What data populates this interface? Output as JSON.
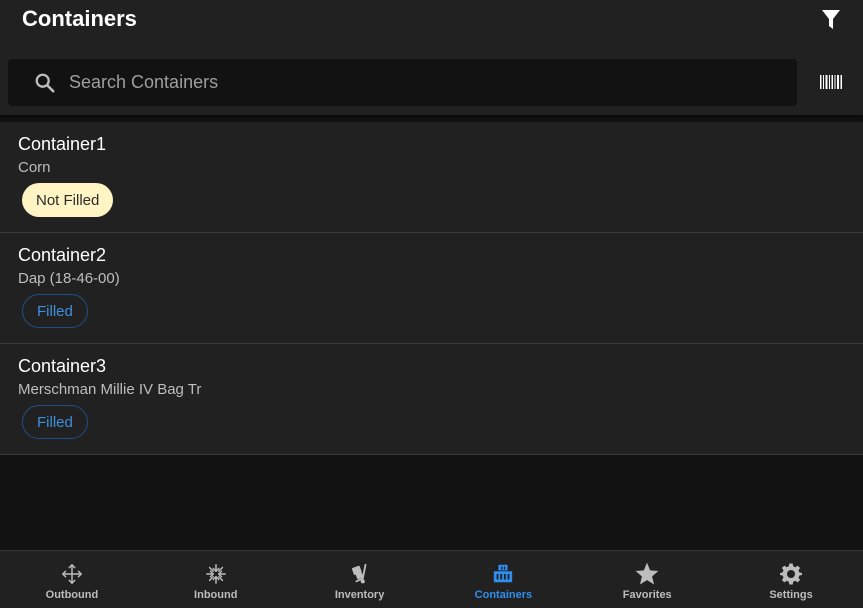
{
  "header": {
    "title": "Containers",
    "filter_icon": "filter-icon"
  },
  "search": {
    "placeholder": "Search Containers",
    "value": "",
    "search_icon": "search-icon",
    "barcode_icon": "barcode-icon"
  },
  "containers": [
    {
      "name": "Container1",
      "product": "Corn",
      "status": "Not Filled"
    },
    {
      "name": "Container2",
      "product": "Dap (18-46-00)",
      "status": "Filled"
    },
    {
      "name": "Container3",
      "product": "Merschman Millie IV Bag Tr",
      "status": "Filled"
    }
  ],
  "nav": {
    "items": [
      {
        "label": "Outbound",
        "icon": "move-arrows-icon"
      },
      {
        "label": "Inbound",
        "icon": "inward-arrows-icon"
      },
      {
        "label": "Inventory",
        "icon": "hand-truck-icon"
      },
      {
        "label": "Containers",
        "icon": "containers-icon"
      },
      {
        "label": "Favorites",
        "icon": "star-icon"
      },
      {
        "label": "Settings",
        "icon": "gear-icon"
      }
    ],
    "active": "Containers"
  },
  "colors": {
    "accent": "#2f8ff0",
    "header_bg": "#212121",
    "page_bg": "#121212",
    "not_filled_bg": "#fff5c4",
    "filled_border": "#1f4f86"
  }
}
